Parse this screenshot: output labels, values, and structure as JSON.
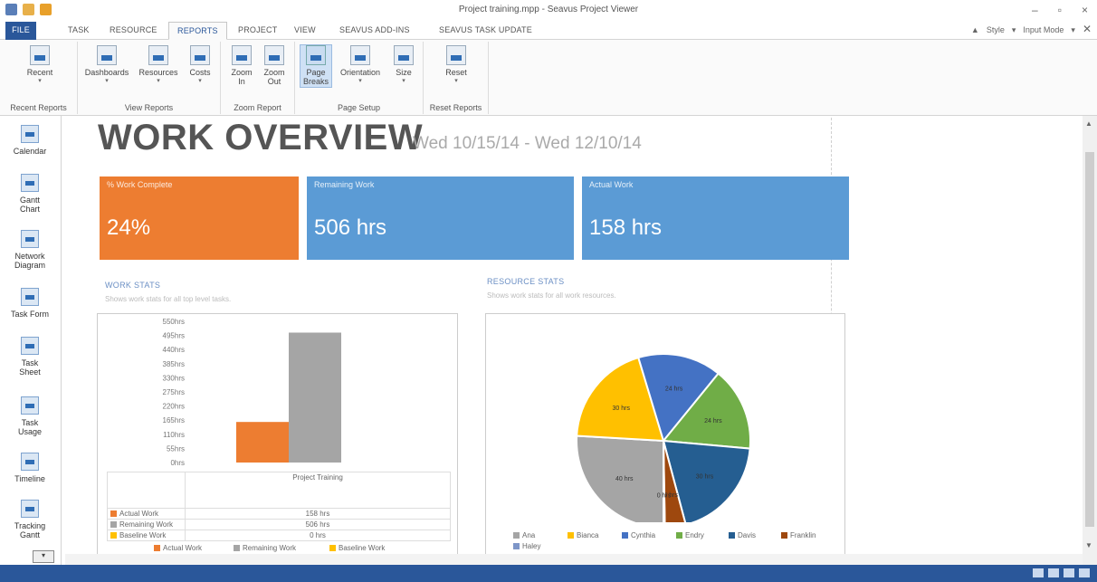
{
  "app": {
    "title": "Project training.mpp - Seavus Project Viewer"
  },
  "tabs": [
    {
      "label": "FILE"
    },
    {
      "label": "TASK"
    },
    {
      "label": "RESOURCE"
    },
    {
      "label": "REPORTS"
    },
    {
      "label": "PROJECT"
    },
    {
      "label": "VIEW"
    },
    {
      "label": "SEAVUS ADD-INS"
    },
    {
      "label": "SEAVUS TASK UPDATE"
    }
  ],
  "tabs_right": {
    "style": "Style",
    "input_mode": "Input Mode"
  },
  "ribbon": {
    "groups": [
      {
        "label": "Recent Reports",
        "buttons": [
          {
            "line1": "Recent",
            "line2": ""
          }
        ]
      },
      {
        "label": "View Reports",
        "buttons": [
          {
            "line1": "Dashboards",
            "line2": ""
          },
          {
            "line1": "Resources",
            "line2": ""
          },
          {
            "line1": "Costs",
            "line2": ""
          }
        ]
      },
      {
        "label": "Zoom Report",
        "buttons": [
          {
            "line1": "Zoom",
            "line2": "In"
          },
          {
            "line1": "Zoom",
            "line2": "Out"
          }
        ]
      },
      {
        "label": "Page Setup",
        "buttons": [
          {
            "line1": "Page",
            "line2": "Breaks"
          },
          {
            "line1": "Orientation",
            "line2": ""
          },
          {
            "line1": "Size",
            "line2": ""
          }
        ]
      },
      {
        "label": "Reset Reports",
        "buttons": [
          {
            "line1": "Reset",
            "line2": ""
          }
        ]
      }
    ]
  },
  "leftnav": {
    "items": [
      {
        "line1": "Calendar",
        "line2": ""
      },
      {
        "line1": "Gantt",
        "line2": "Chart"
      },
      {
        "line1": "Network",
        "line2": "Diagram"
      },
      {
        "line1": "Task Form",
        "line2": ""
      },
      {
        "line1": "Task",
        "line2": "Sheet"
      },
      {
        "line1": "Task",
        "line2": "Usage"
      },
      {
        "line1": "Timeline",
        "line2": ""
      },
      {
        "line1": "Tracking",
        "line2": "Gantt"
      }
    ]
  },
  "report": {
    "title": "WORK OVERVIEW",
    "date_range": "Wed 10/15/14 - Wed 12/10/14",
    "kpis": [
      {
        "label": "% Work Complete",
        "value": "24%",
        "color": "#ed7d31"
      },
      {
        "label": "Remaining Work",
        "value": "506 hrs",
        "color": "#5b9bd5"
      },
      {
        "label": "Actual Work",
        "value": "158 hrs",
        "color": "#5b9bd5"
      }
    ],
    "work_stats": {
      "title": "WORK STATS",
      "subtitle": "Shows work stats for all top level tasks."
    },
    "resource_stats": {
      "title": "RESOURCE STATS",
      "subtitle": "Shows work stats for all work resources."
    }
  },
  "chart_data": [
    {
      "type": "bar",
      "categories": [
        "Project Training"
      ],
      "series": [
        {
          "name": "Actual Work",
          "values": [
            158
          ],
          "label": "158 hrs",
          "color": "#ed7d31"
        },
        {
          "name": "Remaining Work",
          "values": [
            506
          ],
          "label": "506 hrs",
          "color": "#a5a5a5"
        },
        {
          "name": "Baseline Work",
          "values": [
            0
          ],
          "label": "0 hrs",
          "color": "#ffc000"
        }
      ],
      "yticks": [
        "550hrs",
        "495hrs",
        "440hrs",
        "385hrs",
        "330hrs",
        "275hrs",
        "220hrs",
        "165hrs",
        "110hrs",
        "55hrs",
        "0hrs"
      ],
      "ylim": [
        0,
        550
      ]
    },
    {
      "type": "pie",
      "slices": [
        {
          "name": "Ana",
          "value": 40,
          "label": "40 hrs",
          "color": "#a5a5a5"
        },
        {
          "name": "Bianca",
          "value": 30,
          "label": "30 hrs",
          "color": "#ffc000"
        },
        {
          "name": "Cynthia",
          "value": 24,
          "label": "24 hrs",
          "color": "#4472c4"
        },
        {
          "name": "Endry",
          "value": 24,
          "label": "24 hrs",
          "color": "#70ad47"
        },
        {
          "name": "Davis",
          "value": 30,
          "label": "30 hrs",
          "color": "#255e91"
        },
        {
          "name": "Franklin",
          "value": 6,
          "label": "6 hrs",
          "color": "#9e480e"
        },
        {
          "name": "Haley",
          "value": 0.4,
          "label": "0 hrs",
          "color": "#7e96c8"
        }
      ]
    }
  ]
}
